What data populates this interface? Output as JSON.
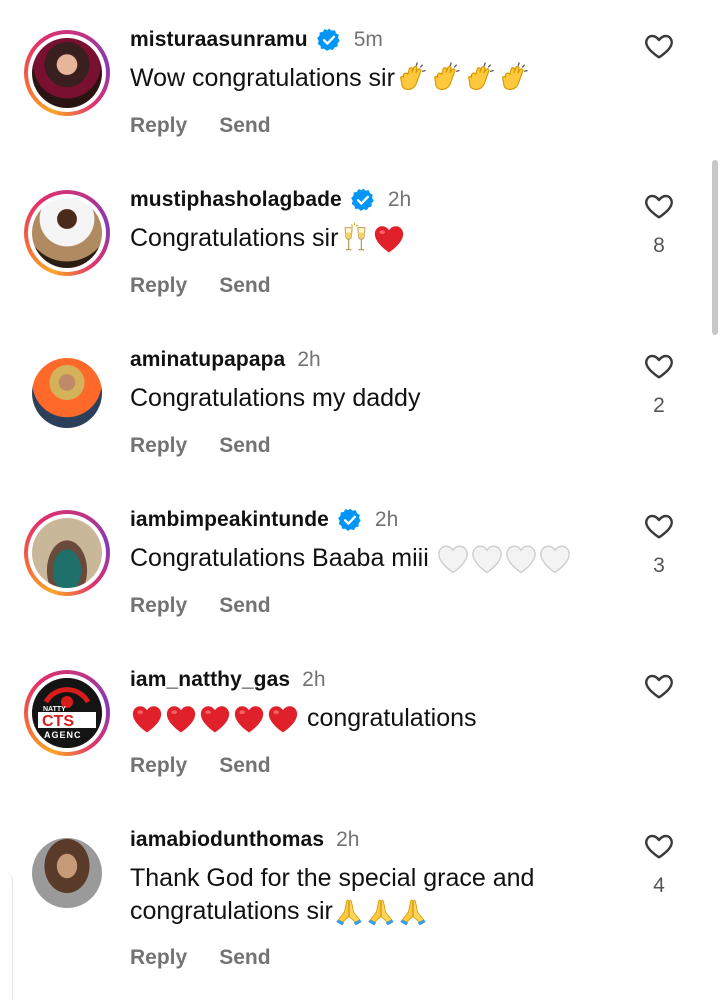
{
  "actions": {
    "reply": "Reply",
    "send": "Send"
  },
  "comments": [
    {
      "username": "misturaasunramu",
      "verified": true,
      "time": "5m",
      "text": "Wow congratulations sir",
      "emoji": "clapping-hands x4",
      "likes": ""
    },
    {
      "username": "mustiphasholagbade",
      "verified": true,
      "time": "2h",
      "text": "Congratulations sir",
      "emoji": "champagne-glasses, red-heart",
      "likes": "8"
    },
    {
      "username": "aminatupapapa",
      "verified": false,
      "time": "2h",
      "text": "Congratulations my daddy",
      "emoji": "",
      "likes": "2"
    },
    {
      "username": "iambimpeakintunde",
      "verified": true,
      "time": "2h",
      "text": "Congratulations Baaba miii",
      "emoji": "white-heart x4",
      "likes": "3"
    },
    {
      "username": "iam_natthy_gas",
      "verified": false,
      "time": "2h",
      "text": "congratulations",
      "emoji": "red-heart x5",
      "likes": "",
      "avatar_text": [
        "NATTY",
        "CTS",
        "AGENC"
      ]
    },
    {
      "username": "iamabiodunthomas",
      "verified": false,
      "time": "2h",
      "text_line1": "Thank God for the special grace and",
      "text_line2": "congratulations sir",
      "emoji": "folded-hands x3",
      "likes": "4"
    }
  ],
  "colors": {
    "accent_verified": "#0095f6",
    "muted": "#737373",
    "heart_red": "#e0202a"
  }
}
